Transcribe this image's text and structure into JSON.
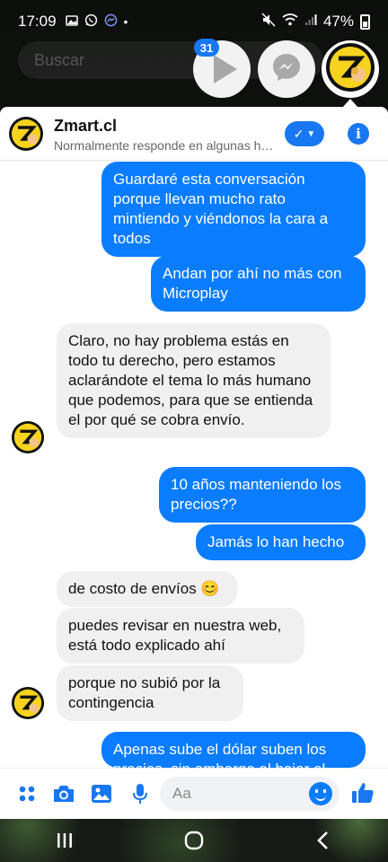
{
  "status_bar": {
    "time": "17:09",
    "battery": "47%",
    "dot": "•"
  },
  "search": {
    "placeholder": "Buscar"
  },
  "chat_heads": {
    "badge_count": "31",
    "items": [
      "play-icon",
      "messenger-icon",
      "zmart-avatar"
    ]
  },
  "conversation": {
    "name": "Zmart.cl",
    "status": "Normalmente responde en algunas horas",
    "messages": [
      {
        "side": "out",
        "text": "Guardaré esta conversación porque llevan mucho rato mintiendo y viéndonos la cara a todos"
      },
      {
        "side": "out",
        "text": "Andan por ahí no más con Microplay"
      },
      {
        "side": "in",
        "text": "Claro, no hay problema estás en todo tu derecho, pero estamos aclarándote el tema lo más humano que podemos, para que se entienda el por qué se cobra envío."
      },
      {
        "side": "out",
        "text": "10 años manteniendo los precios??"
      },
      {
        "side": "out",
        "text": "Jamás lo han hecho"
      },
      {
        "side": "in",
        "text": "de costo de envíos 😊"
      },
      {
        "side": "in",
        "text": "puedes revisar en nuestra web, está todo explicado ahí"
      },
      {
        "side": "in",
        "text": "porque no subió por la contingencia"
      },
      {
        "side": "out",
        "text": "Apenas sube el dólar suben los precios, sin embargo al bajar el"
      }
    ]
  },
  "composer": {
    "placeholder": "Aa"
  },
  "colors": {
    "accent": "#1877f2",
    "outgoing_bubble": "#0a7cff",
    "incoming_bubble": "#f0f0f0"
  }
}
